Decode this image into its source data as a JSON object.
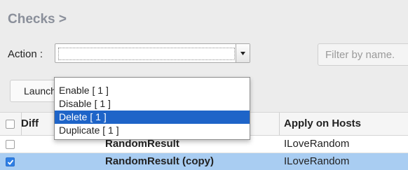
{
  "page": {
    "title": "Checks >"
  },
  "toolbar": {
    "action_label": "Action :",
    "action_value": "",
    "filter_placeholder": "Filter by name.",
    "launch_label": "Launch"
  },
  "dropdown": {
    "options": [
      {
        "label": "Enable [ 1 ]",
        "selected": false
      },
      {
        "label": "Disable [ 1 ]",
        "selected": false
      },
      {
        "label": "Delete [ 1 ]",
        "selected": true
      },
      {
        "label": "Duplicate [ 1 ]",
        "selected": false
      }
    ]
  },
  "table": {
    "headers": {
      "diff": "Diff",
      "name": "",
      "hosts": "Apply on Hosts"
    },
    "rows": [
      {
        "name": "RandomResult",
        "hosts": "ILoveRandom",
        "checked": false
      },
      {
        "name": "RandomResult (copy)",
        "hosts": "ILoveRandom",
        "checked": true
      }
    ]
  },
  "colors": {
    "selection": "#1e64c8",
    "row_selected": "#a9cdf2",
    "checkbox_checked": "#2f7fe5"
  }
}
